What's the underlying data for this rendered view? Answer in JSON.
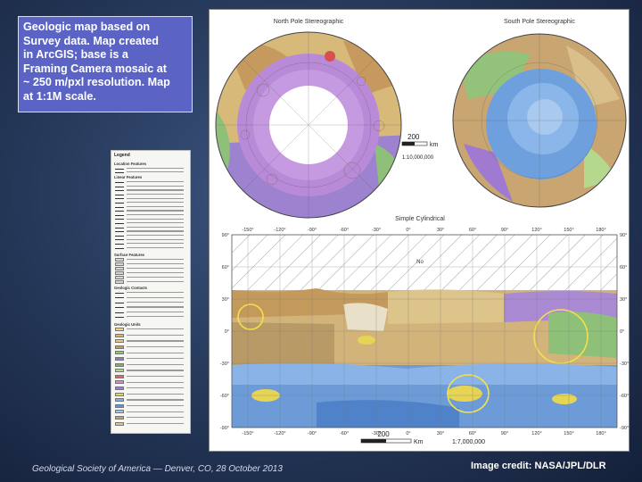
{
  "caption": {
    "lines": [
      "Geologic map based on",
      "Survey data. Map created",
      "in ArcGIS; base is a",
      "Framing Camera mosaic at",
      "~ 250 m/pxl resolution. Map",
      "at 1:1M scale."
    ]
  },
  "maps": {
    "north_title": "North Pole Stereographic",
    "south_title": "South Pole Stereographic",
    "polar_scale_value": "200",
    "polar_scale_unit": "km",
    "polar_scale_ratio": "1:10,000,000",
    "cyl_title": "Simple Cylindrical",
    "cyl_lon_labels": [
      "-150°",
      "-120°",
      "-90°",
      "-60°",
      "-30°",
      "0°",
      "30°",
      "60°",
      "90°",
      "120°",
      "150°",
      "180°"
    ],
    "cyl_lat_labels": [
      "90°",
      "60°",
      "30°",
      "0°",
      "-30°",
      "-60°",
      "-90°"
    ],
    "cyl_region_label": "No",
    "cyl_scale_value": "200",
    "cyl_scale_unit": "Km",
    "cyl_scale_ratio": "1:7,000,000"
  },
  "legend": {
    "title": "Legend",
    "sections": [
      "Location Features",
      "Linear Features",
      "Surface Features",
      "Geologic Contacts",
      "Geologic Units"
    ],
    "unit_colors": [
      "#f1d38a",
      "#d9b46a",
      "#e5c98c",
      "#c49a5c",
      "#93c37a",
      "#8f7dc4",
      "#7fae6e",
      "#b5d98c",
      "#d86a6a",
      "#c58fd9",
      "#a07ad0",
      "#e3d36b",
      "#7fb0e0",
      "#5f95d6",
      "#9ec2ea",
      "#b9a27a",
      "#d8c59a"
    ]
  },
  "footer": {
    "left": "Geological Society of America — Denver, CO, 28 October 2013",
    "right": "Image credit: NASA/JPL/DLR"
  }
}
